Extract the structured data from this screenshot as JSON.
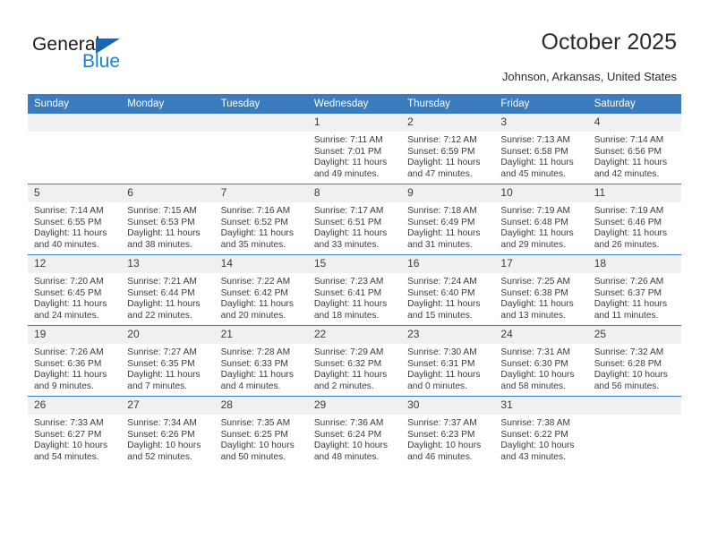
{
  "branding": {
    "name_dark": "General",
    "name_blue": "Blue",
    "accent_color": "#1b7fd4",
    "triangle_color": "#1667b8"
  },
  "header": {
    "title": "October 2025",
    "subtitle": "Johnson, Arkansas, United States",
    "header_row_color": "#3a7cbe",
    "daynum_band_color": "#f0f0f0"
  },
  "weekdays": [
    "Sunday",
    "Monday",
    "Tuesday",
    "Wednesday",
    "Thursday",
    "Friday",
    "Saturday"
  ],
  "labels": {
    "sunrise": "Sunrise:",
    "sunset": "Sunset:",
    "daylight": "Daylight:"
  },
  "weeks": [
    [
      {
        "day": "",
        "sunrise": "",
        "sunset": "",
        "daylight": "",
        "empty": true
      },
      {
        "day": "",
        "sunrise": "",
        "sunset": "",
        "daylight": "",
        "empty": true
      },
      {
        "day": "",
        "sunrise": "",
        "sunset": "",
        "daylight": "",
        "empty": true
      },
      {
        "day": "1",
        "sunrise": "Sunrise: 7:11 AM",
        "sunset": "Sunset: 7:01 PM",
        "daylight": "Daylight: 11 hours and 49 minutes."
      },
      {
        "day": "2",
        "sunrise": "Sunrise: 7:12 AM",
        "sunset": "Sunset: 6:59 PM",
        "daylight": "Daylight: 11 hours and 47 minutes."
      },
      {
        "day": "3",
        "sunrise": "Sunrise: 7:13 AM",
        "sunset": "Sunset: 6:58 PM",
        "daylight": "Daylight: 11 hours and 45 minutes."
      },
      {
        "day": "4",
        "sunrise": "Sunrise: 7:14 AM",
        "sunset": "Sunset: 6:56 PM",
        "daylight": "Daylight: 11 hours and 42 minutes."
      }
    ],
    [
      {
        "day": "5",
        "sunrise": "Sunrise: 7:14 AM",
        "sunset": "Sunset: 6:55 PM",
        "daylight": "Daylight: 11 hours and 40 minutes."
      },
      {
        "day": "6",
        "sunrise": "Sunrise: 7:15 AM",
        "sunset": "Sunset: 6:53 PM",
        "daylight": "Daylight: 11 hours and 38 minutes."
      },
      {
        "day": "7",
        "sunrise": "Sunrise: 7:16 AM",
        "sunset": "Sunset: 6:52 PM",
        "daylight": "Daylight: 11 hours and 35 minutes."
      },
      {
        "day": "8",
        "sunrise": "Sunrise: 7:17 AM",
        "sunset": "Sunset: 6:51 PM",
        "daylight": "Daylight: 11 hours and 33 minutes."
      },
      {
        "day": "9",
        "sunrise": "Sunrise: 7:18 AM",
        "sunset": "Sunset: 6:49 PM",
        "daylight": "Daylight: 11 hours and 31 minutes."
      },
      {
        "day": "10",
        "sunrise": "Sunrise: 7:19 AM",
        "sunset": "Sunset: 6:48 PM",
        "daylight": "Daylight: 11 hours and 29 minutes."
      },
      {
        "day": "11",
        "sunrise": "Sunrise: 7:19 AM",
        "sunset": "Sunset: 6:46 PM",
        "daylight": "Daylight: 11 hours and 26 minutes."
      }
    ],
    [
      {
        "day": "12",
        "sunrise": "Sunrise: 7:20 AM",
        "sunset": "Sunset: 6:45 PM",
        "daylight": "Daylight: 11 hours and 24 minutes."
      },
      {
        "day": "13",
        "sunrise": "Sunrise: 7:21 AM",
        "sunset": "Sunset: 6:44 PM",
        "daylight": "Daylight: 11 hours and 22 minutes."
      },
      {
        "day": "14",
        "sunrise": "Sunrise: 7:22 AM",
        "sunset": "Sunset: 6:42 PM",
        "daylight": "Daylight: 11 hours and 20 minutes."
      },
      {
        "day": "15",
        "sunrise": "Sunrise: 7:23 AM",
        "sunset": "Sunset: 6:41 PM",
        "daylight": "Daylight: 11 hours and 18 minutes."
      },
      {
        "day": "16",
        "sunrise": "Sunrise: 7:24 AM",
        "sunset": "Sunset: 6:40 PM",
        "daylight": "Daylight: 11 hours and 15 minutes."
      },
      {
        "day": "17",
        "sunrise": "Sunrise: 7:25 AM",
        "sunset": "Sunset: 6:38 PM",
        "daylight": "Daylight: 11 hours and 13 minutes."
      },
      {
        "day": "18",
        "sunrise": "Sunrise: 7:26 AM",
        "sunset": "Sunset: 6:37 PM",
        "daylight": "Daylight: 11 hours and 11 minutes."
      }
    ],
    [
      {
        "day": "19",
        "sunrise": "Sunrise: 7:26 AM",
        "sunset": "Sunset: 6:36 PM",
        "daylight": "Daylight: 11 hours and 9 minutes."
      },
      {
        "day": "20",
        "sunrise": "Sunrise: 7:27 AM",
        "sunset": "Sunset: 6:35 PM",
        "daylight": "Daylight: 11 hours and 7 minutes."
      },
      {
        "day": "21",
        "sunrise": "Sunrise: 7:28 AM",
        "sunset": "Sunset: 6:33 PM",
        "daylight": "Daylight: 11 hours and 4 minutes."
      },
      {
        "day": "22",
        "sunrise": "Sunrise: 7:29 AM",
        "sunset": "Sunset: 6:32 PM",
        "daylight": "Daylight: 11 hours and 2 minutes."
      },
      {
        "day": "23",
        "sunrise": "Sunrise: 7:30 AM",
        "sunset": "Sunset: 6:31 PM",
        "daylight": "Daylight: 11 hours and 0 minutes."
      },
      {
        "day": "24",
        "sunrise": "Sunrise: 7:31 AM",
        "sunset": "Sunset: 6:30 PM",
        "daylight": "Daylight: 10 hours and 58 minutes."
      },
      {
        "day": "25",
        "sunrise": "Sunrise: 7:32 AM",
        "sunset": "Sunset: 6:28 PM",
        "daylight": "Daylight: 10 hours and 56 minutes."
      }
    ],
    [
      {
        "day": "26",
        "sunrise": "Sunrise: 7:33 AM",
        "sunset": "Sunset: 6:27 PM",
        "daylight": "Daylight: 10 hours and 54 minutes."
      },
      {
        "day": "27",
        "sunrise": "Sunrise: 7:34 AM",
        "sunset": "Sunset: 6:26 PM",
        "daylight": "Daylight: 10 hours and 52 minutes."
      },
      {
        "day": "28",
        "sunrise": "Sunrise: 7:35 AM",
        "sunset": "Sunset: 6:25 PM",
        "daylight": "Daylight: 10 hours and 50 minutes."
      },
      {
        "day": "29",
        "sunrise": "Sunrise: 7:36 AM",
        "sunset": "Sunset: 6:24 PM",
        "daylight": "Daylight: 10 hours and 48 minutes."
      },
      {
        "day": "30",
        "sunrise": "Sunrise: 7:37 AM",
        "sunset": "Sunset: 6:23 PM",
        "daylight": "Daylight: 10 hours and 46 minutes."
      },
      {
        "day": "31",
        "sunrise": "Sunrise: 7:38 AM",
        "sunset": "Sunset: 6:22 PM",
        "daylight": "Daylight: 10 hours and 43 minutes."
      },
      {
        "day": "",
        "sunrise": "",
        "sunset": "",
        "daylight": "",
        "empty": true
      }
    ]
  ]
}
